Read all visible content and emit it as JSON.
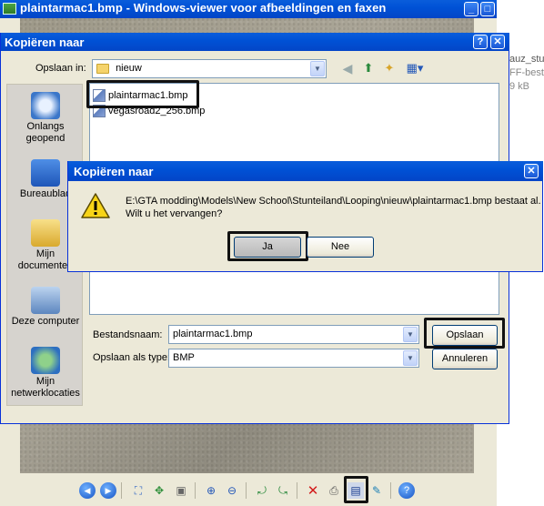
{
  "viewer": {
    "title": "plaintarmac1.bmp - Windows-viewer voor afbeeldingen en faxen",
    "toolbar_icons": [
      "previous-icon",
      "next-icon",
      "best-fit-icon",
      "actual-size-icon",
      "slideshow-icon",
      "zoom-in-icon",
      "zoom-out-icon",
      "rotate-clockwise-icon",
      "rotate-counterclockwise-icon",
      "delete-icon",
      "print-icon",
      "save-icon",
      "edit-icon",
      "help-icon"
    ]
  },
  "side_window": {
    "lines": [
      "auz_stu",
      "FF-besta",
      "9 kB"
    ]
  },
  "save_dialog": {
    "title": "Kopiëren naar",
    "help_btn": "?",
    "close_btn": "✕",
    "save_in_label": "Opslaan in:",
    "save_in_value": "nieuw",
    "places": [
      {
        "label": "Onlangs geopend",
        "icon": "recent-documents-icon"
      },
      {
        "label": "Bureaublad",
        "icon": "desktop-icon"
      },
      {
        "label": "Mijn documenten",
        "icon": "my-documents-icon"
      },
      {
        "label": "Deze computer",
        "icon": "my-computer-icon"
      },
      {
        "label": "Mijn netwerklocaties",
        "icon": "network-places-icon"
      }
    ],
    "files": [
      "plaintarmac1.bmp",
      "vegasroad2_256.bmp"
    ],
    "filename_label": "Bestandsnaam:",
    "filename_value": "plaintarmac1.bmp",
    "type_label": "Opslaan als type:",
    "type_value": "BMP",
    "save_button": "Opslaan",
    "cancel_button": "Annuleren"
  },
  "confirm_dialog": {
    "title": "Kopiëren naar",
    "close_btn": "✕",
    "message_line1": "E:\\GTA modding\\Models\\New School\\Stunteiland\\Looping\\nieuw\\plaintarmac1.bmp bestaat al.",
    "message_line2": "Wilt u het vervangen?",
    "yes_button": "Ja",
    "no_button": "Nee"
  }
}
